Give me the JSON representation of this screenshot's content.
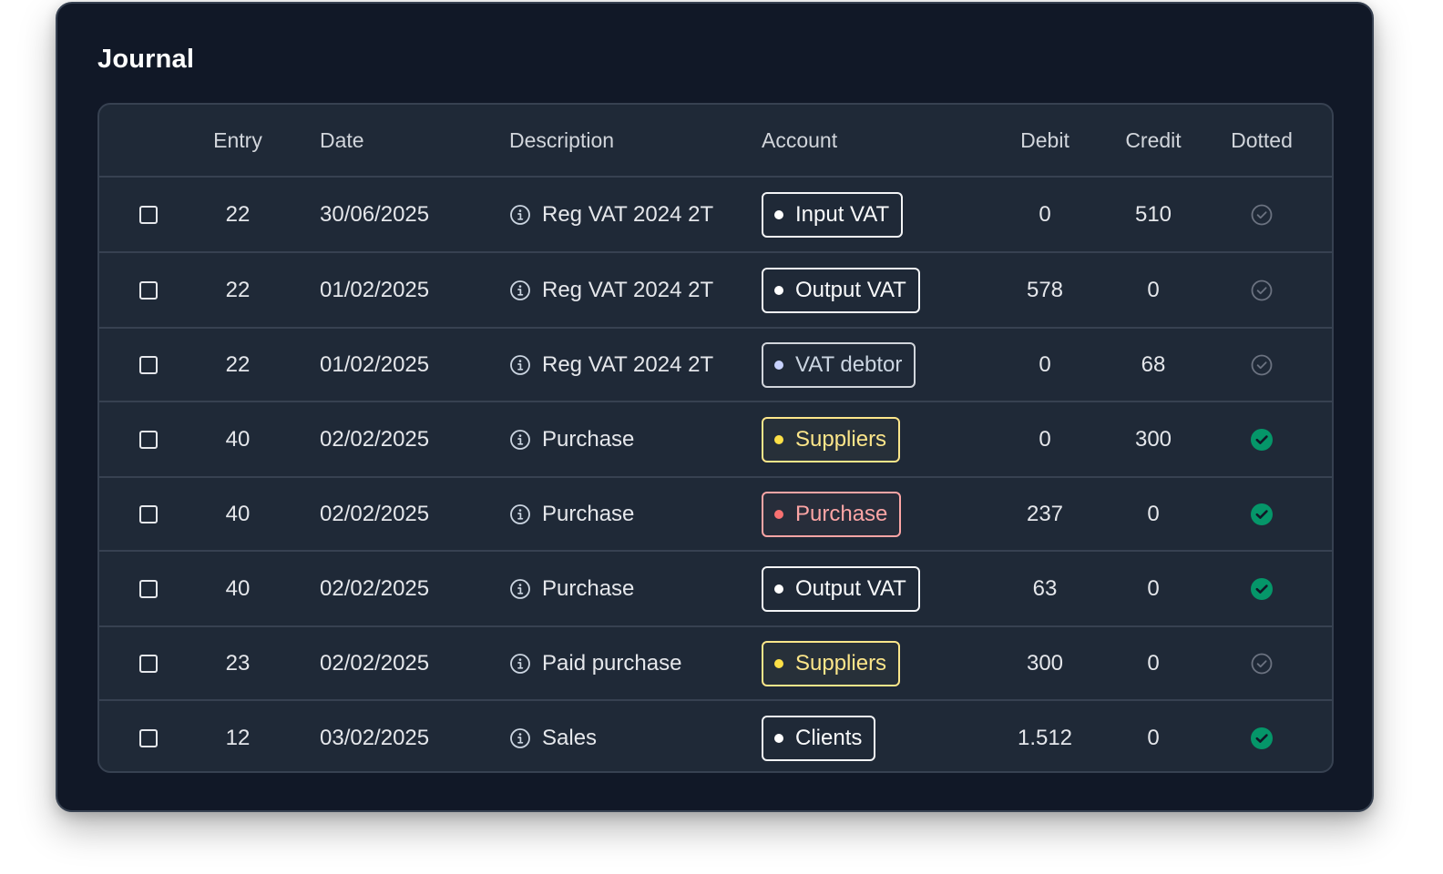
{
  "title": "Journal",
  "columns": {
    "entry": "Entry",
    "date": "Date",
    "description": "Description",
    "account": "Account",
    "debit": "Debit",
    "credit": "Credit",
    "dotted": "Dotted"
  },
  "colors": {
    "card_bg": "#111827",
    "table_bg": "#1f2937",
    "border": "#374151",
    "dotted_green": "#059669"
  },
  "rows": [
    {
      "entry": "22",
      "date": "30/06/2025",
      "description": "Reg VAT 2024 2T",
      "account": "Input VAT",
      "account_color": "white",
      "debit": "0",
      "credit": "510",
      "dotted": false
    },
    {
      "entry": "22",
      "date": "01/02/2025",
      "description": "Reg VAT 2024 2T",
      "account": "Output VAT",
      "account_color": "white",
      "debit": "578",
      "credit": "0",
      "dotted": false
    },
    {
      "entry": "22",
      "date": "01/02/2025",
      "description": "Reg VAT 2024 2T",
      "account": "VAT debtor",
      "account_color": "gray",
      "debit": "0",
      "credit": "68",
      "dotted": false
    },
    {
      "entry": "40",
      "date": "02/02/2025",
      "description": "Purchase",
      "account": "Suppliers",
      "account_color": "yellow",
      "debit": "0",
      "credit": "300",
      "dotted": true
    },
    {
      "entry": "40",
      "date": "02/02/2025",
      "description": "Purchase",
      "account": "Purchase",
      "account_color": "red",
      "debit": "237",
      "credit": "0",
      "dotted": true
    },
    {
      "entry": "40",
      "date": "02/02/2025",
      "description": "Purchase",
      "account": "Output VAT",
      "account_color": "white",
      "debit": "63",
      "credit": "0",
      "dotted": true
    },
    {
      "entry": "23",
      "date": "02/02/2025",
      "description": "Paid purchase",
      "account": "Suppliers",
      "account_color": "yellow",
      "debit": "300",
      "credit": "0",
      "dotted": false
    },
    {
      "entry": "12",
      "date": "03/02/2025",
      "description": "Sales",
      "account": "Clients",
      "account_color": "white",
      "debit": "1.512",
      "credit": "0",
      "dotted": true
    }
  ]
}
